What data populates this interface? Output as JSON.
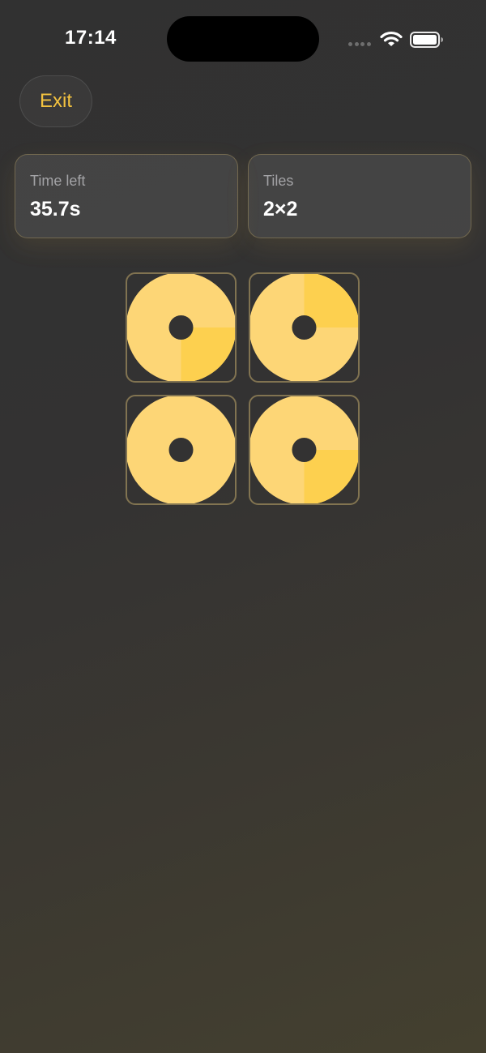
{
  "status_bar": {
    "time": "17:14"
  },
  "exit_label": "Exit",
  "stats": {
    "time_left": {
      "label": "Time left",
      "value": "35.7s"
    },
    "tiles": {
      "label": "Tiles",
      "value": "2×2"
    }
  },
  "colors": {
    "accent": "#f3c23f",
    "tile_light": "#fdd676",
    "tile_dark": "#fdd04f",
    "background": "#333232"
  },
  "board": {
    "grid": "2x2",
    "tiles": [
      {
        "position": "top-left",
        "highlighted_quadrant": "bottom-right"
      },
      {
        "position": "top-right",
        "highlighted_quadrant": "top-right"
      },
      {
        "position": "bottom-left",
        "highlighted_quadrant": "none"
      },
      {
        "position": "bottom-right",
        "highlighted_quadrant": "bottom-right"
      }
    ]
  }
}
